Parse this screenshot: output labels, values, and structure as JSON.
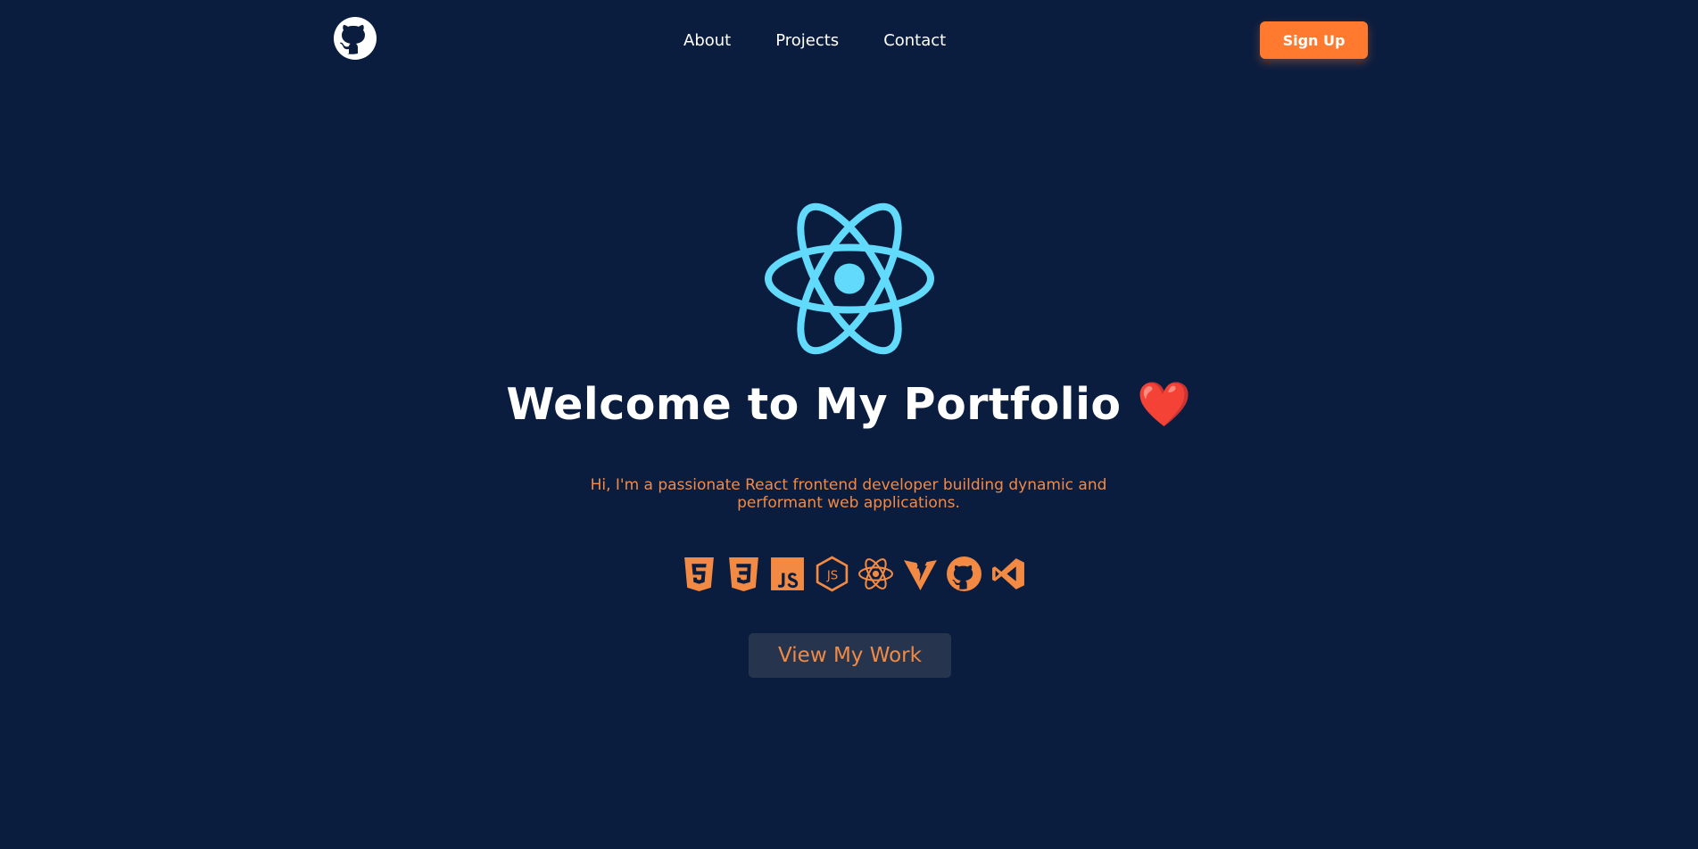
{
  "header": {
    "logo_icon": "github-icon",
    "nav": [
      {
        "label": "About"
      },
      {
        "label": "Projects"
      },
      {
        "label": "Contact"
      }
    ],
    "signup_label": "Sign Up"
  },
  "hero": {
    "logo_icon": "react-icon",
    "title": "Welcome to My Portfolio ❤️",
    "subtitle": "Hi, I'm a passionate React frontend developer building dynamic and performant web applications.",
    "tech_icons": [
      "html5-icon",
      "css3-icon",
      "javascript-icon",
      "nodejs-icon",
      "react-icon",
      "vite-icon",
      "github-icon",
      "vscode-icon"
    ],
    "cta_label": "View My Work"
  },
  "colors": {
    "background": "#0b1d3f",
    "accent": "#ff7a2e",
    "accent_text": "#f28a44",
    "react_blue": "#61dafb",
    "button_dark": "#26344d"
  }
}
